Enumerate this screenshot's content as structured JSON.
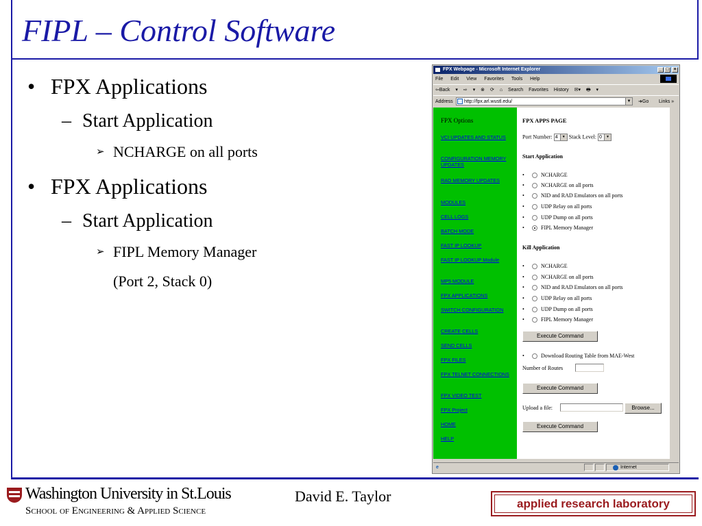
{
  "slide": {
    "title": "FIPL – Control Software",
    "author": "David E. Taylor",
    "university": "Washington University in St.Louis",
    "school": "School of Engineering & Applied Science",
    "lab": "applied research laboratory"
  },
  "bullets": [
    {
      "level": 1,
      "marker": "•",
      "text": "FPX Applications"
    },
    {
      "level": 2,
      "marker": "–",
      "text": "Start Application"
    },
    {
      "level": 3,
      "marker": "➢",
      "text": "NCHARGE on all ports"
    },
    {
      "level": 1,
      "marker": "•",
      "text": "FPX Applications"
    },
    {
      "level": 2,
      "marker": "–",
      "text": "Start Application"
    },
    {
      "level": 3,
      "marker": "➢",
      "text": "FIPL Memory Manager"
    },
    {
      "level": 3,
      "marker": "",
      "text": "(Port 2, Stack 0)"
    }
  ],
  "browser": {
    "title": "FPX Webpage - Microsoft Internet Explorer",
    "window_buttons": [
      "_",
      "□",
      "×"
    ],
    "menu": [
      "File",
      "Edit",
      "View",
      "Favorites",
      "Tools",
      "Help"
    ],
    "toolbar": [
      "⇦Back",
      "▾",
      "⇨",
      "▾",
      "⊗",
      "⟳",
      "⌂",
      "Search",
      "Favorites",
      "History",
      "✉▾",
      "🖶",
      "▾",
      "Links »"
    ],
    "address_label": "Address",
    "address_value": "http://fpx.arl.wustl.edu/",
    "go_label": "Go",
    "links_label": "Links »",
    "status_zone": "Internet",
    "status_icon": "e"
  },
  "nav": {
    "title": "FPX Options",
    "links": [
      "VCI UPDATES AND STATUS",
      "CONFIGURATION MEMORY UPDATES",
      "RAD MEMORY UPDATES",
      "MODULES",
      "CELL LOGS",
      "BATCH MODE",
      "FAST IP LOOKUP",
      "FAST IP LOOKUP Module",
      "MP5 MODULE",
      "FPX APPLICATIONS",
      "SWITCH CONFIGURATION",
      "CREATE CELLS",
      "SEND CELLS",
      "FPX FILES",
      "FPX TELNET CONNECTIONS",
      "FPX VIDEO TEST",
      "FPX Project",
      "HOME",
      "HELP"
    ]
  },
  "main": {
    "heading": "FPX APPS PAGE",
    "port_label": "Port Number:",
    "port_value": "4",
    "stack_label": "Stack Level:",
    "stack_value": "0",
    "start_title": "Start Application",
    "start_options": [
      {
        "label": "NCHARGE",
        "selected": false
      },
      {
        "label": "NCHARGE on all ports",
        "selected": false
      },
      {
        "label": "NID and RAD Emulators on all ports",
        "selected": false
      },
      {
        "label": "UDP Relay on all ports",
        "selected": false
      },
      {
        "label": "UDP Dump on all ports",
        "selected": false
      },
      {
        "label": "FIPL Memory Manager",
        "selected": true
      }
    ],
    "kill_title": "Kill Application",
    "kill_options": [
      {
        "label": "NCHARGE",
        "selected": false
      },
      {
        "label": "NCHARGE on all ports",
        "selected": false
      },
      {
        "label": "NID and RAD Emulators on all ports",
        "selected": false
      },
      {
        "label": "UDP Relay on all ports",
        "selected": false
      },
      {
        "label": "UDP Dump on all ports",
        "selected": false
      },
      {
        "label": "FIPL Memory Manager",
        "selected": false
      }
    ],
    "execute_label": "Execute Command",
    "download_option": {
      "label": "Download Routing Table from MAE-West",
      "selected": false
    },
    "routes_label": "Number of Routes",
    "routes_value": "",
    "upload_label": "Upload a file:",
    "upload_value": "",
    "browse_label": "Browse..."
  }
}
